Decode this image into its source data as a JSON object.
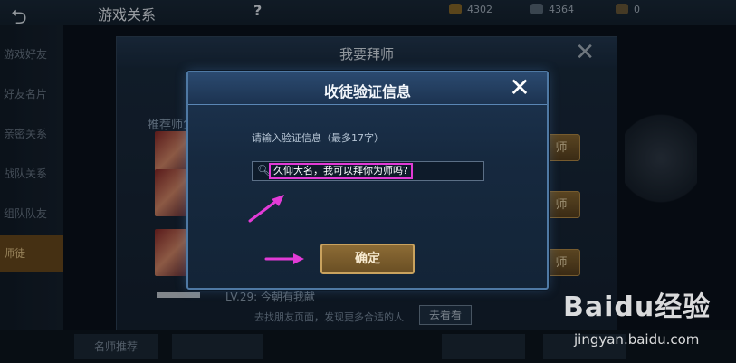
{
  "background": {
    "topbar": {
      "back_icon": "back-arrow-icon",
      "title": "游戏关系",
      "help": "?",
      "currencies": [
        {
          "icon": "coin-icon",
          "value": "4302",
          "color": "#8a6a2a"
        },
        {
          "icon": "diamond-icon",
          "value": "4364",
          "color": "#5a6a7a"
        },
        {
          "icon": "trophy-icon",
          "value": "0",
          "color": "#6a5a3a"
        }
      ]
    },
    "sidebar": [
      {
        "label": "游戏好友"
      },
      {
        "label": "好友名片"
      },
      {
        "label": "亲密关系"
      },
      {
        "label": "战队关系"
      },
      {
        "label": "组队队友"
      },
      {
        "label": "师徒",
        "active": true
      }
    ],
    "panel": {
      "title": "我要拜师",
      "recommend_label": "推荐师父",
      "gold_button_label": "师",
      "lv_text": "LV.29: 今朝有我献",
      "find_text": "去找朋友页面，发现更多合适的人",
      "look_button": "去看看"
    },
    "bottom": {
      "left_button": "名师推荐"
    }
  },
  "modal": {
    "title": "收徒验证信息",
    "close_icon": "close-icon",
    "prompt": "请输入验证信息（最多17字）",
    "search_icon": "search-icon",
    "input_value": "久仰大名，我可以拜你为师吗?",
    "confirm_label": "确定"
  },
  "annotation": {
    "color": "#e23bd6"
  },
  "watermark": {
    "logo": "Baidu经验",
    "url": "jingyan.baidu.com"
  }
}
